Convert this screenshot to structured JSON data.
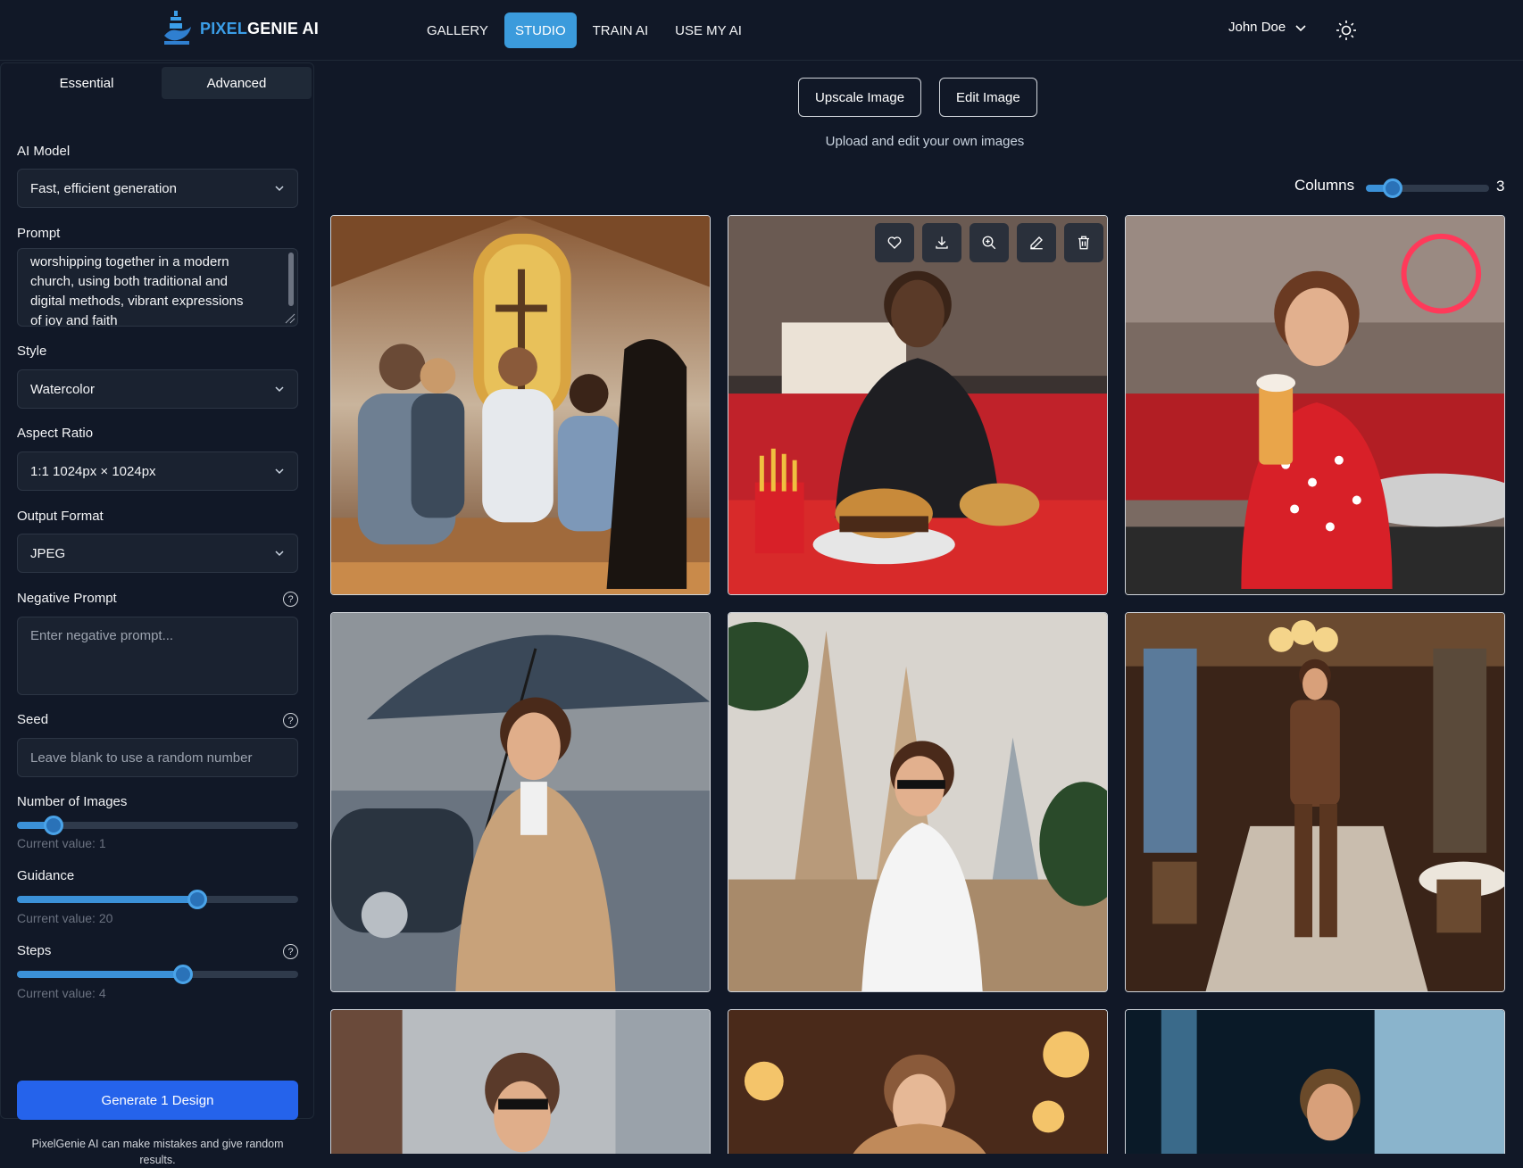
{
  "brand": {
    "name_part1": "PIXEL",
    "name_part2": "GENIE AI"
  },
  "nav": {
    "items": [
      {
        "label": "GALLERY",
        "active": false
      },
      {
        "label": "STUDIO",
        "active": true
      },
      {
        "label": "TRAIN AI",
        "active": false
      },
      {
        "label": "USE MY AI",
        "active": false
      }
    ]
  },
  "user": {
    "name": "John Doe"
  },
  "sidebar": {
    "tabs": [
      "Essential",
      "Advanced"
    ],
    "ai_model": {
      "label": "AI Model",
      "value": "Fast, efficient generation"
    },
    "prompt": {
      "label": "Prompt",
      "value": "worshipping together in a modern church, using both traditional and digital methods, vibrant expressions of joy and faith"
    },
    "style": {
      "label": "Style",
      "value": "Watercolor"
    },
    "aspect": {
      "label": "Aspect Ratio",
      "value": "1:1 1024px × 1024px"
    },
    "format": {
      "label": "Output Format",
      "value": "JPEG"
    },
    "negative": {
      "label": "Negative Prompt",
      "placeholder": "Enter negative prompt..."
    },
    "seed": {
      "label": "Seed",
      "placeholder": "Leave blank to use a random number"
    },
    "num_images": {
      "label": "Number of Images",
      "current": "Current value: 1",
      "fraction": 0.13
    },
    "guidance": {
      "label": "Guidance",
      "current": "Current value: 20",
      "fraction": 0.64
    },
    "steps": {
      "label": "Steps",
      "current": "Current value: 4",
      "fraction": 0.59
    },
    "generate_label": "Generate 1 Design",
    "disclaimer": "PixelGenie AI can make mistakes and give random results."
  },
  "main": {
    "upscale_label": "Upscale Image",
    "edit_label": "Edit Image",
    "subtitle": "Upload and edit your own images",
    "columns_label": "Columns",
    "columns_value": "3"
  },
  "colors": {
    "accent": "#3b9bdc",
    "primary": "#2563eb",
    "background": "#111827"
  }
}
